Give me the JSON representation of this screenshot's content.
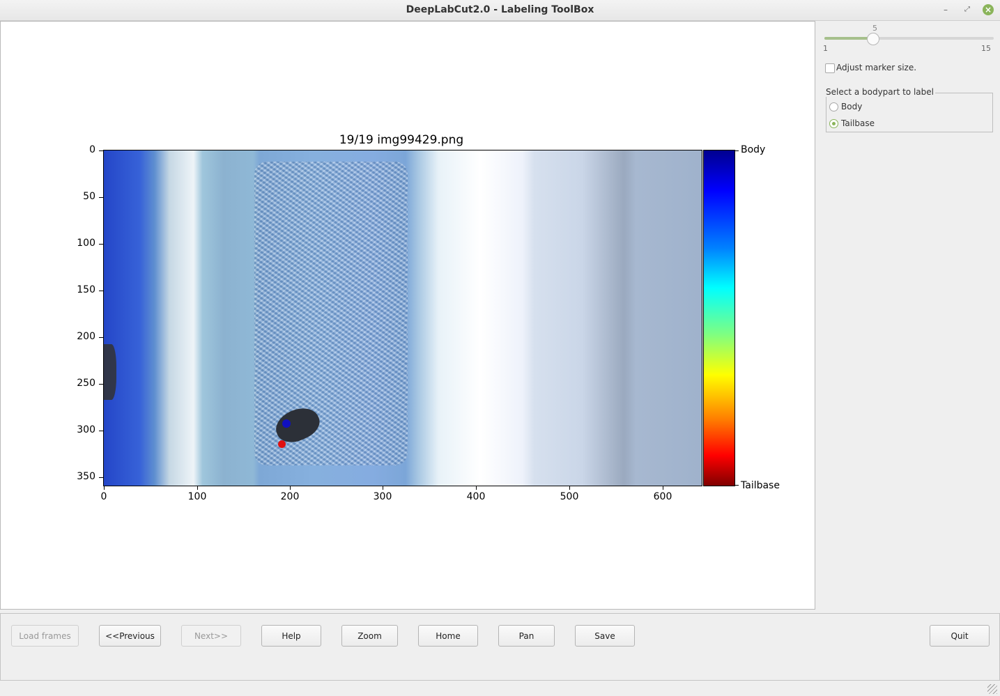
{
  "window": {
    "title": "DeepLabCut2.0 - Labeling ToolBox"
  },
  "plot": {
    "title": "19/19 img99429.png",
    "y_ticks": [
      "0",
      "50",
      "100",
      "150",
      "200",
      "250",
      "300",
      "350"
    ],
    "x_ticks": [
      "0",
      "100",
      "200",
      "300",
      "400",
      "500",
      "600"
    ],
    "colorbar": {
      "top_label": "Body",
      "bottom_label": "Tailbase"
    }
  },
  "side_panel": {
    "slider": {
      "value": "5",
      "min": "1",
      "max": "15",
      "fraction": 0.2857
    },
    "adjust_marker_label": "Adjust marker size.",
    "bodypart_group_title": "Select a bodypart to label",
    "bodyparts": [
      {
        "label": "Body",
        "selected": false
      },
      {
        "label": "Tailbase",
        "selected": true
      }
    ]
  },
  "buttons": {
    "load_frames": "Load frames",
    "previous": "<<Previous",
    "next": "Next>>",
    "help": "Help",
    "zoom": "Zoom",
    "home": "Home",
    "pan": "Pan",
    "save": "Save",
    "quit": "Quit"
  },
  "colors": {
    "accent": "#8ab45a"
  }
}
